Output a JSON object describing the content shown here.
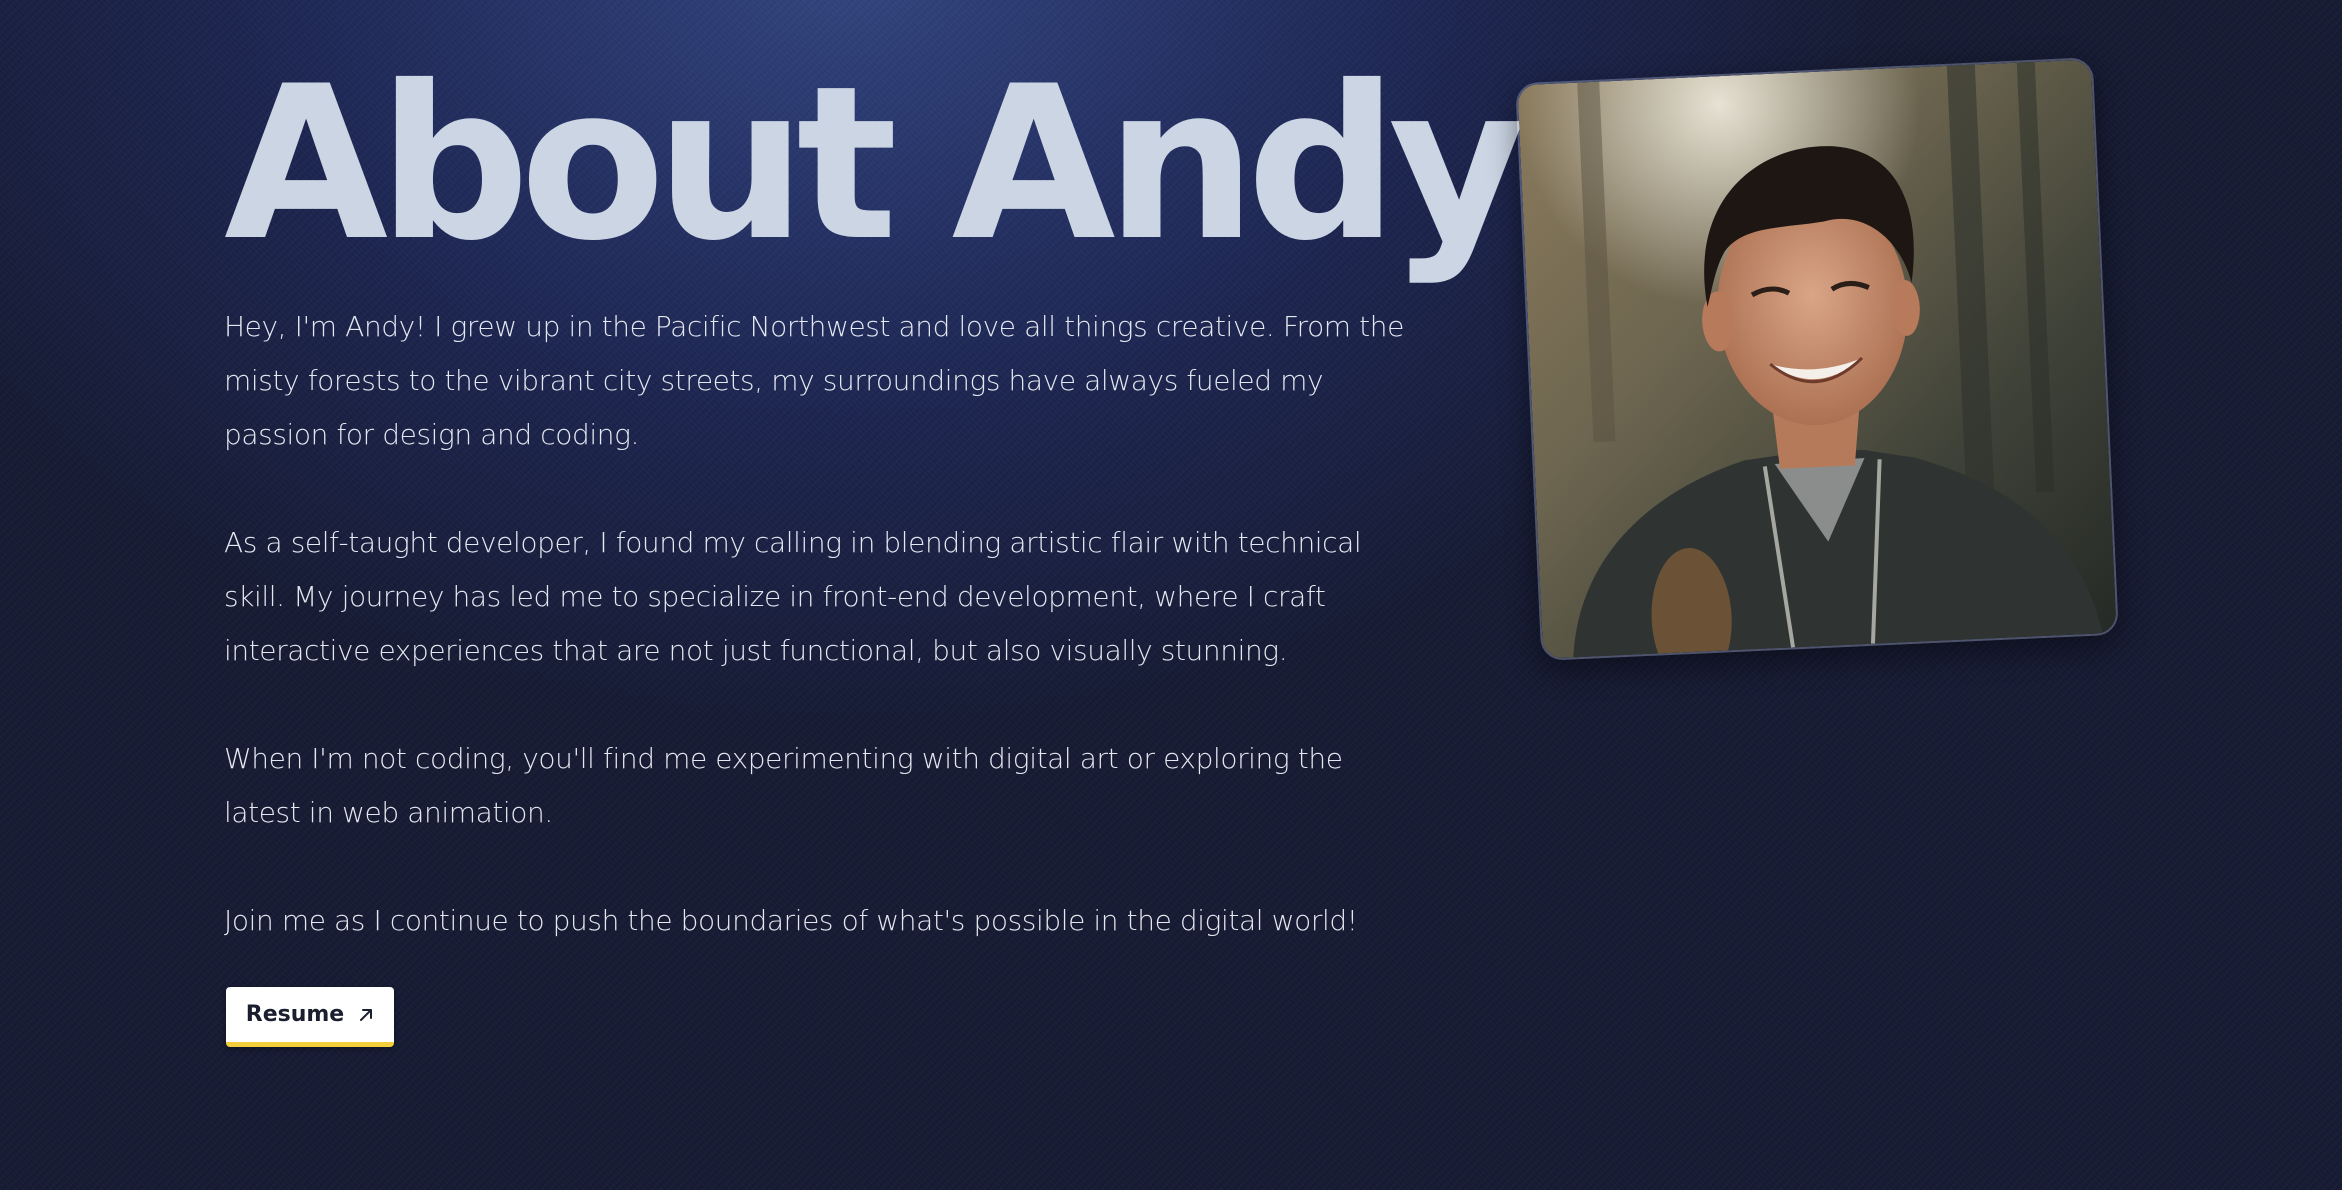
{
  "page": {
    "title": "About Andy"
  },
  "bio": {
    "paragraphs": [
      "Hey, I'm Andy! I grew up in the Pacific Northwest and love all things creative. From the misty forests to the vibrant city streets, my surroundings have always fueled my passion for design and coding.",
      "As a self-taught developer, I found my calling in blending artistic flair with technical skill. My journey has led me to specialize in front-end development, where I craft interactive experiences that are not just functional, but also visually stunning.",
      "When I'm not coding, you'll find me experimenting with digital art or exploring the latest in web animation.",
      "Join me as I continue to push the boundaries of what's possible in the digital world!"
    ]
  },
  "resume": {
    "label": "Resume",
    "icon": "arrow-up-right-icon"
  },
  "photo": {
    "icon": "portrait-photo"
  },
  "colors": {
    "background_top": "#33467f",
    "background_bottom": "#151a33",
    "title": "#cbd5e3",
    "body_text": "#e4e8f0",
    "button_bg": "#ffffff",
    "button_accent": "#f2cf3a"
  }
}
